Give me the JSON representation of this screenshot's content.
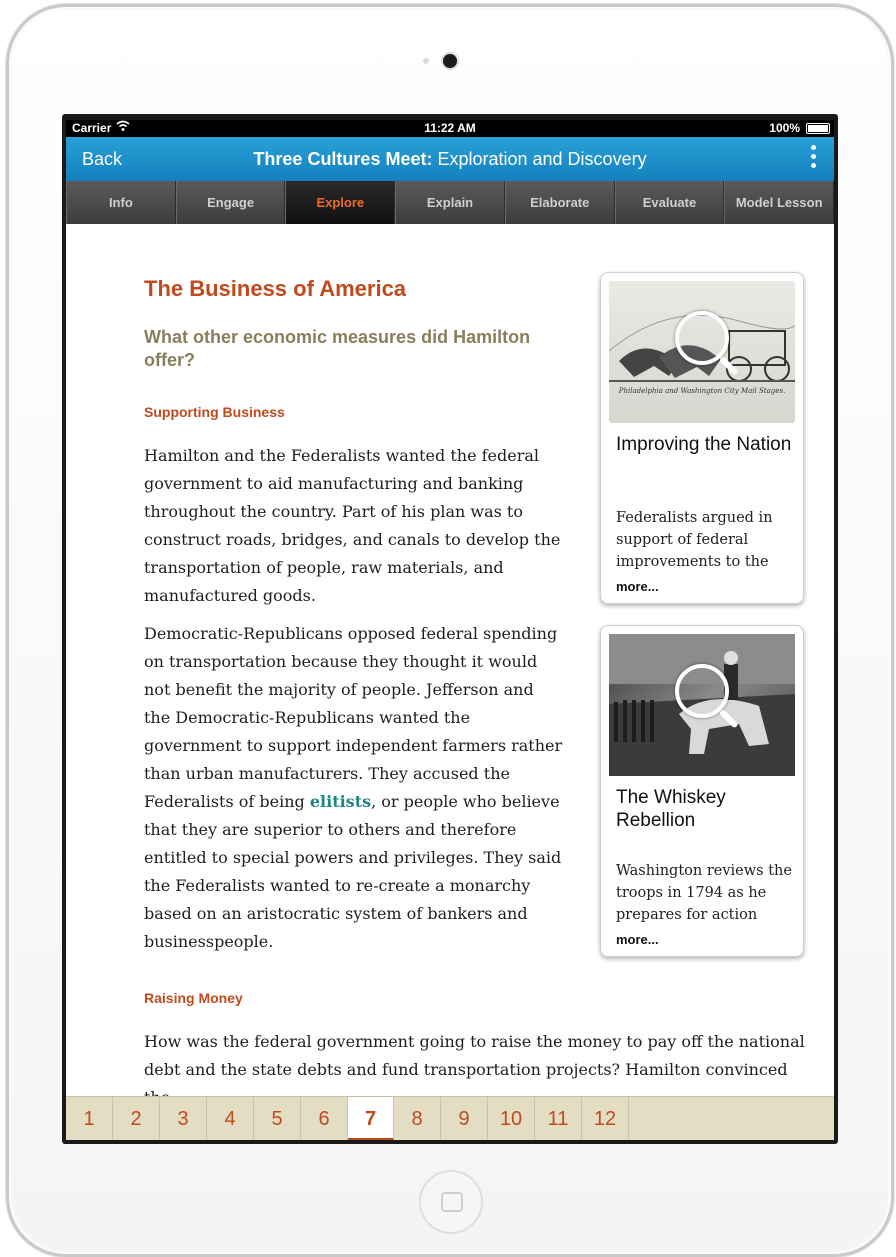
{
  "status": {
    "carrier": "Carrier",
    "time": "11:22 AM",
    "battery": "100%"
  },
  "nav": {
    "back": "Back",
    "title_bold": "Three Cultures Meet:",
    "title_rest": " Exploration and Discovery"
  },
  "tabs": [
    {
      "label": "Info"
    },
    {
      "label": "Engage"
    },
    {
      "label": "Explore"
    },
    {
      "label": "Explain"
    },
    {
      "label": "Elaborate"
    },
    {
      "label": "Evaluate"
    },
    {
      "label": "Model Lesson"
    }
  ],
  "article": {
    "title": "The Business of America",
    "question": "What other economic measures did Hamilton offer?",
    "section1": "Supporting Business",
    "para1": "Hamilton and the Federalists wanted the federal government to aid manufacturing and banking throughout the country. Part of his plan was to construct roads, bridges, and canals to develop the transportation of people, raw materials, and manufactured goods.",
    "para2_before": "Democratic-Republicans opposed federal spending on transportation because they thought it would not benefit the majority of people. Jefferson and the Democratic-Republicans wanted the government to support independent farmers rather than urban manufacturers. They accused the Federalists of being ",
    "para2_link": "elitists",
    "para2_after": ", or people who believe that they are superior to others and therefore entitled to special powers and privileges. They said the Federalists wanted to re-create a monarchy based on an aristocratic system of bankers and businesspeople.",
    "section2": "Raising Money",
    "para3": "How was the federal government going to raise the money to pay off the national debt and the state debts and fund transportation projects? Hamilton convinced the"
  },
  "cards": [
    {
      "title": "Improving the Nation",
      "caption": "Federalists argued in support of federal improvements to the",
      "more": "more...",
      "image_caption": "Philadelphia and Washington City Mail Stages.",
      "icon": "magnifier-icon"
    },
    {
      "title": "The Whiskey Rebellion",
      "caption": "Washington reviews the troops in 1794 as he prepares for action",
      "more": "more...",
      "icon": "magnifier-icon"
    }
  ],
  "pages": [
    "1",
    "2",
    "3",
    "4",
    "5",
    "6",
    "7",
    "8",
    "9",
    "10",
    "11",
    "12"
  ],
  "current_page": "7",
  "colors": {
    "accent": "#c14a1c",
    "nav_blue": "#1a8ccb",
    "link": "#1f8486",
    "subhead": "#8a7f5c"
  }
}
